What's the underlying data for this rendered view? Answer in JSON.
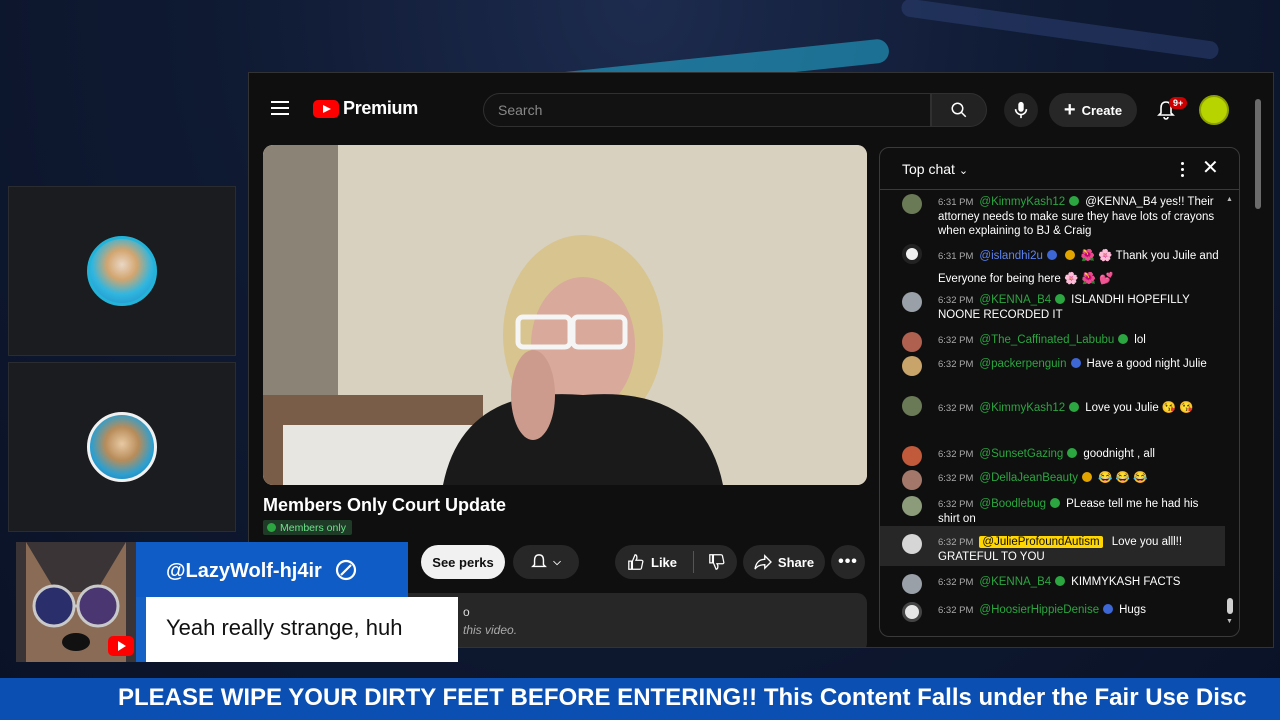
{
  "youtube": {
    "brand": "Premium",
    "search_placeholder": "Search",
    "create_label": "Create",
    "notification_count": "9+",
    "video_title": "Members Only Court Update",
    "members_badge": "Members only",
    "see_perks_label": "See perks",
    "like_label": "Like",
    "share_label": "Share",
    "description_partial": "o",
    "description_partial_2": "this video."
  },
  "chat": {
    "header_title": "Top chat",
    "messages": [
      {
        "time": "6:31 PM",
        "author": "@KimmyKash12",
        "text": "@KENNA_B4 yes!! Their attorney needs to make sure they have lots of crayons when explaining to BJ & Craig"
      },
      {
        "time": "6:31 PM",
        "author": "@islandhi2u",
        "text": "🌺 🌸 Thank you Juile and Everyone for being here 🌸 🌺 💕"
      },
      {
        "time": "6:32 PM",
        "author": "@KENNA_B4",
        "text": "ISLANDHI HOPEFILLY NOONE RECORDED IT"
      },
      {
        "time": "6:32 PM",
        "author": "@The_Caffinated_Labubu",
        "text": "lol"
      },
      {
        "time": "6:32 PM",
        "author": "@packerpenguin",
        "text": "Have a good night Julie"
      },
      {
        "time": "6:32 PM",
        "author": "@KimmyKash12",
        "text": "Love you Julie 😘 😘"
      },
      {
        "time": "6:32 PM",
        "author": "@SunsetGazing",
        "text": "goodnight , all"
      },
      {
        "time": "6:32 PM",
        "author": "@DellaJeanBeauty",
        "text": "😂 😂 😂"
      },
      {
        "time": "6:32 PM",
        "author": "@Boodlebug",
        "text": "PLease tell me he had his shirt on"
      },
      {
        "time": "6:32 PM",
        "author": "@JulieProfoundAutism",
        "text": "Love you alll!! GRATEFUL TO YOU"
      },
      {
        "time": "6:32 PM",
        "author": "@KENNA_B4",
        "text": "KIMMYKASH FACTS"
      },
      {
        "time": "6:32 PM",
        "author": "@HoosierHippieDenise",
        "text": "Hugs"
      }
    ]
  },
  "overlay": {
    "commenter_name": "@LazyWolf-hj4ir",
    "comment_text": "Yeah really strange, huh",
    "ticker_text": "PLEASE WIPE YOUR DIRTY FEET BEFORE ENTERING!! This Content Falls under the Fair Use Disc"
  },
  "colors": {
    "youtube_red": "#ff0000",
    "member_green": "#2ba640",
    "moderator_blue": "#5e84f1",
    "owner_highlight": "#ffd600",
    "overlay_blue": "#0f5cc6",
    "ticker_blue": "#0b4fb3"
  }
}
